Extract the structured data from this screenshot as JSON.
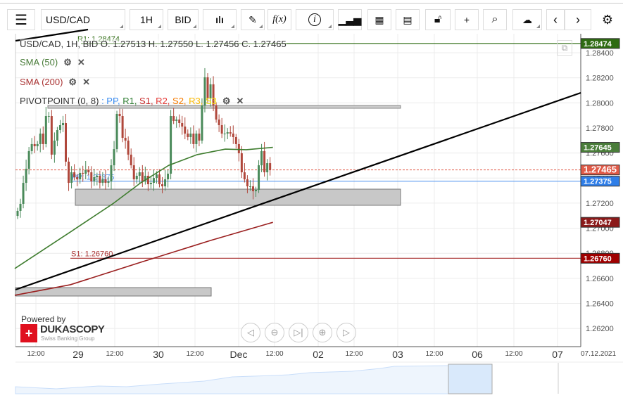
{
  "toolbar": {
    "symbol": "USD/CAD",
    "period": "1H",
    "side": "BID",
    "fx_label": "f(x)",
    "info_label": "i"
  },
  "legend": {
    "ohlc": "USD/CAD, 1H, BID  O. 1.27513 H. 1.27550 L. 1.27456 C. 1.27465",
    "sma50": "SMA (50)",
    "sma200": "SMA (200)",
    "pivot": "PIVOTPOINT (0, 8)",
    "pivot_items": [
      {
        "t": ": PP,",
        "c": "#3b8cf0"
      },
      {
        "t": " R1,",
        "c": "#2e7d32"
      },
      {
        "t": " S1,",
        "c": "#c62828"
      },
      {
        "t": " R2,",
        "c": "#e53935"
      },
      {
        "t": " S2,",
        "c": "#f57c00"
      },
      {
        "t": " R3,",
        "c": "#f9b800"
      },
      {
        "t": " S3",
        "c": "#f5e000"
      }
    ]
  },
  "lines": {
    "pp_label": "PP: 1.27375",
    "s1_label": "S1: 1.26760",
    "r1_label": "R1: 1.28474"
  },
  "price_tags": [
    {
      "v": "1.28474",
      "price": 1.28474,
      "bg": "#2e6b12"
    },
    {
      "v": "1.27645",
      "price": 1.27645,
      "bg": "#4a7d3a"
    },
    {
      "v": "1.27465",
      "price": 1.27465,
      "bg": "#e05a48"
    },
    {
      "v": "1.27375",
      "price": 1.27375,
      "bg": "#2f7ee8"
    },
    {
      "v": "1.27047",
      "price": 1.27047,
      "bg": "#8b1a1a"
    },
    {
      "v": "1.26760",
      "price": 1.2676,
      "bg": "#a00000"
    }
  ],
  "y_ticks": [
    "1.28400",
    "1.28200",
    "1.28000",
    "1.27800",
    "1.27600",
    "1.27400",
    "1.27200",
    "1.27000",
    "1.26800",
    "1.26600",
    "1.26400",
    "1.26200"
  ],
  "x_labels": [
    {
      "t": "12:00",
      "big": false
    },
    {
      "t": "29",
      "big": true
    },
    {
      "t": "12:00",
      "big": false
    },
    {
      "t": "30",
      "big": true
    },
    {
      "t": "12:00",
      "big": false
    },
    {
      "t": "Dec",
      "big": true
    },
    {
      "t": "12:00",
      "big": false
    },
    {
      "t": "02",
      "big": true
    },
    {
      "t": "12:00",
      "big": false
    },
    {
      "t": "03",
      "big": true
    },
    {
      "t": "12:00",
      "big": false
    },
    {
      "t": "06",
      "big": true
    },
    {
      "t": "12:00",
      "big": false
    },
    {
      "t": "07",
      "big": true
    }
  ],
  "date_label": "07.12.2021",
  "brand": {
    "powered": "Powered by",
    "name": "DUKASCOPY",
    "sub": "Swiss Banking Group"
  },
  "chart_data": {
    "type": "candlestick",
    "symbol": "USD/CAD",
    "timeframe": "1H",
    "ylim": [
      1.261,
      1.2855
    ],
    "closes": [
      1.27138,
      1.27194,
      1.27362,
      1.27474,
      1.27615,
      1.27671,
      1.27654,
      1.27671,
      1.27755,
      1.27671,
      1.27895,
      1.27895,
      1.27587,
      1.27699,
      1.27783,
      1.27822,
      1.27839,
      1.27531,
      1.27362,
      1.27446,
      1.27407,
      1.2739,
      1.27441,
      1.27435,
      1.27463,
      1.27446,
      1.27373,
      1.27407,
      1.27418,
      1.27362,
      1.2739,
      1.27362,
      1.27373,
      1.27502,
      1.27631,
      1.27912,
      1.27895,
      1.27721,
      1.27699,
      1.27587,
      1.27502,
      1.2739,
      1.27418,
      1.27446,
      1.27373,
      1.27418,
      1.27351,
      1.27362,
      1.27401,
      1.27429,
      1.27351,
      1.27334,
      1.2739,
      1.27435,
      1.27895,
      1.27856,
      1.27867,
      1.27839,
      1.27811,
      1.27755,
      1.27727,
      1.27755,
      1.27671,
      1.27755,
      1.27699,
      1.27979,
      1.28204,
      1.28035,
      1.28148,
      1.27979,
      1.27867,
      1.27822,
      1.27755,
      1.27755,
      1.27766,
      1.27755,
      1.27727,
      1.27671,
      1.27598,
      1.27446,
      1.2739,
      1.27334,
      1.27334,
      1.27295,
      1.27306,
      1.27502,
      1.27615,
      1.27446,
      1.27519,
      1.27465
    ],
    "sma50": [
      [
        -1,
        1.26678
      ],
      [
        18.6,
        1.2697
      ],
      [
        33.5,
        1.27194
      ],
      [
        43.4,
        1.27362
      ],
      [
        53.3,
        1.27502
      ],
      [
        63.3,
        1.27587
      ],
      [
        73.2,
        1.27631
      ],
      [
        80.6,
        1.27626
      ],
      [
        90,
        1.27645
      ]
    ],
    "sma200": [
      [
        -1,
        1.26465
      ],
      [
        18.6,
        1.26549
      ],
      [
        43.4,
        1.26728
      ],
      [
        68,
        1.26902
      ],
      [
        90,
        1.27047
      ]
    ],
    "pp": 1.27375,
    "r1": 1.28474,
    "s1": 1.2676,
    "last": 1.27465
  }
}
